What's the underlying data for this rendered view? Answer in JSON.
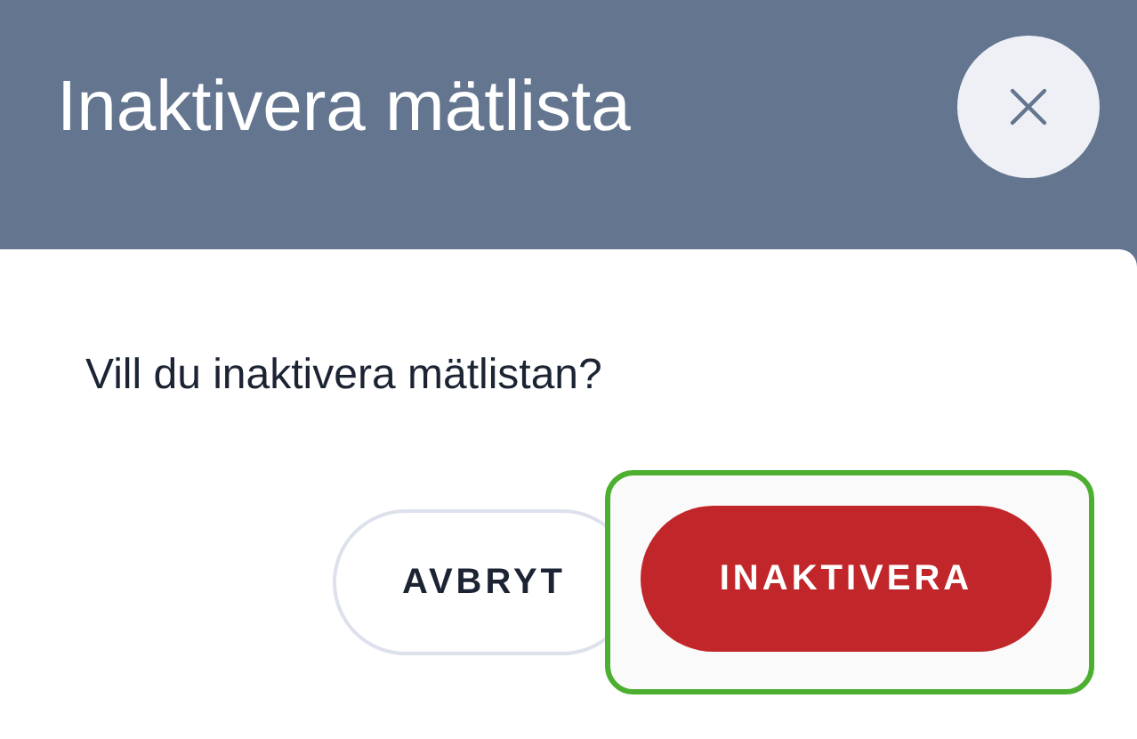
{
  "dialog": {
    "title": "Inaktivera mätlista",
    "message": "Vill du inaktivera mätlistan?",
    "buttons": [
      {
        "label": "AVBRYT",
        "kind": "secondary",
        "focused": false
      },
      {
        "label": "INAKTIVERA",
        "kind": "danger",
        "focused": true
      }
    ]
  }
}
